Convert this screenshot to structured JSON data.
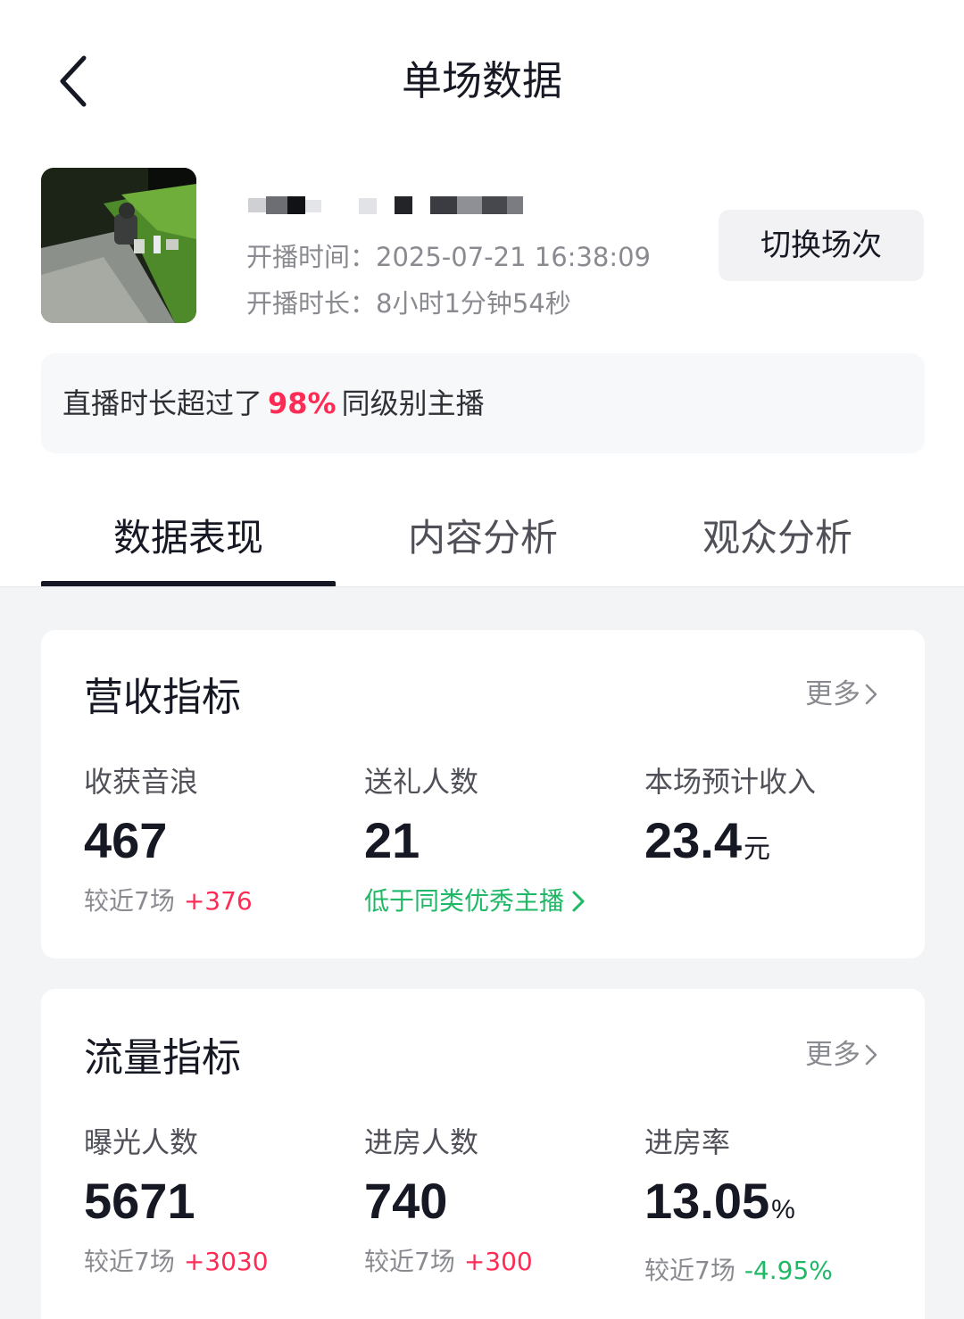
{
  "header": {
    "title": "单场数据"
  },
  "live": {
    "start_time": "开播时间：2025-07-21 16:38:09",
    "duration": "开播时长：8小时1分钟54秒",
    "switch_label": "切换场次"
  },
  "rank_banner": {
    "prefix": "直播时长超过了",
    "percent": "98%",
    "suffix": "同级别主播"
  },
  "tabs": [
    {
      "label": "数据表现",
      "active": true
    },
    {
      "label": "内容分析",
      "active": false
    },
    {
      "label": "观众分析",
      "active": false
    }
  ],
  "revenue": {
    "title": "营收指标",
    "more_label": "更多",
    "metrics": [
      {
        "label": "收获音浪",
        "value": "467",
        "cmp_label": "较近7场",
        "cmp_value": "+376"
      },
      {
        "label": "送礼人数",
        "value": "21",
        "note": "低于同类优秀主播"
      },
      {
        "label": "本场预计收入",
        "value": "23.4",
        "unit": "元"
      }
    ]
  },
  "traffic": {
    "title": "流量指标",
    "more_label": "更多",
    "metrics": [
      {
        "label": "曝光人数",
        "value": "5671",
        "cmp_label": "较近7场",
        "cmp_value": "+3030"
      },
      {
        "label": "进房人数",
        "value": "740",
        "cmp_label": "较近7场",
        "cmp_value": "+300"
      },
      {
        "label": "进房率",
        "value": "13.05",
        "unit": "%",
        "cmp_label": "较近7场",
        "cmp_value": "-4.95%"
      }
    ]
  },
  "colors": {
    "accent_red": "#fe2c55",
    "accent_green": "#1fb866",
    "text_primary": "#161823",
    "text_secondary": "#8a8b91"
  }
}
